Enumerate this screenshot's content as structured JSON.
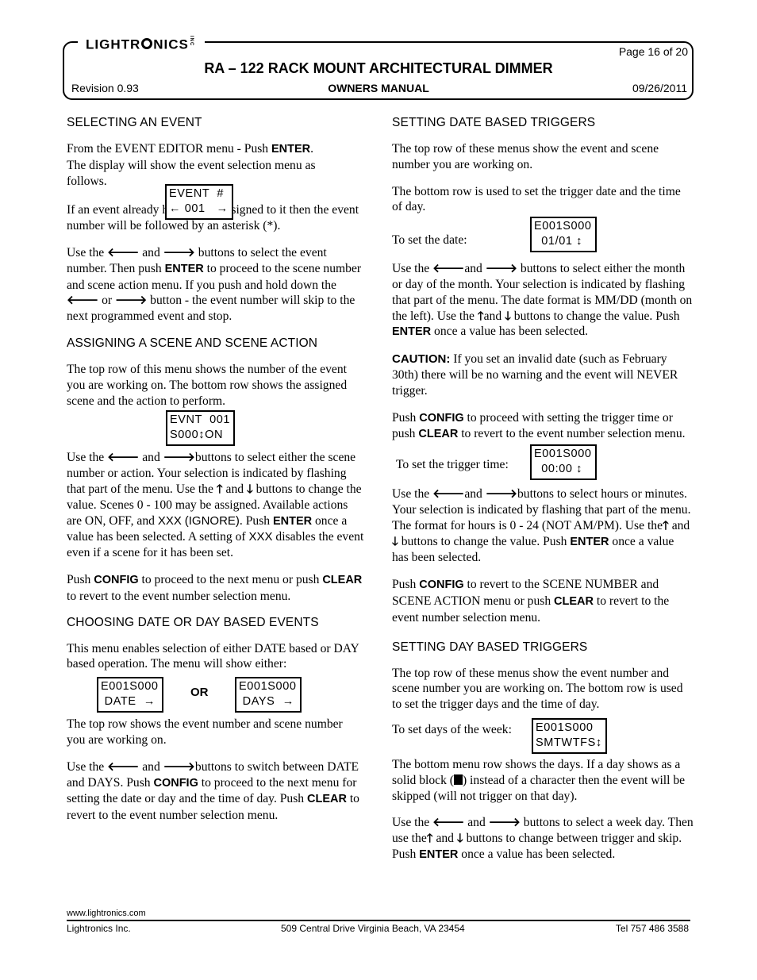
{
  "header": {
    "logo_text_a": "LIGHTR",
    "logo_text_b": "NICS",
    "logo_inc": "INC",
    "page_label": "Page 16 of 20",
    "title": "RA – 122 RACK MOUNT ARCHITECTURAL DIMMER",
    "revision": "Revision 0.93",
    "subtitle": "OWNERS MANUAL",
    "date": "09/26/2011"
  },
  "glyphs": {
    "left": "🡐",
    "right": "🡒",
    "up": "🡑",
    "down": "🡓"
  },
  "left": {
    "s1": {
      "heading": "SELECTING AN EVENT",
      "p1a": "From the EVENT EDITOR menu - Push ",
      "p1k": "ENTER",
      "p1b": ".",
      "p1c": "The display will show the event selection menu as",
      "p1d": "follows.",
      "lcd1": "EVENT  #",
      "lcd2": "← 001   →",
      "p2": "If an event already has a scene assigned to it then the event number will be followed by an asterisk (*).",
      "p3a": "Use the ",
      "p3b": "  and ",
      "p3c": " buttons to select the event number. Then push ",
      "p3k": "ENTER",
      "p3d": " to proceed to the scene number and scene action menu.  If you push and hold down the ",
      "p3e": " or ",
      "p3f": " button - the event number will skip to the next programmed event and stop."
    },
    "s2": {
      "heading": "ASSIGNING A SCENE AND SCENE ACTION",
      "p1": "The top row of this menu shows the number of the event you are working on.  The bottom row shows the assigned scene and the action to perform.",
      "lcd1": "EVNT  001",
      "lcd2": "S000↕ON",
      "p2a": "Use the ",
      "p2b": " and ",
      "p2c": "buttons to select either the scene number or action. Your selection is indicated by flashing that part of the menu.  Use the ",
      "p2d": " and ",
      "p2e": " buttons to change the value.  Scenes 0 - 100 may be assigned.  Available actions are ON, OFF, and ",
      "p2x": "XXX",
      "p2ig": "(IGNORE)",
      "p2f": ".  Push ",
      "p2k": "ENTER",
      "p2g": " once a value has been selected.  A setting of ",
      "p2x2": "XXX",
      "p2h": " disables the event even if a scene for it has been set.",
      "p3a": "Push ",
      "p3k1": "CONFIG",
      "p3b": " to proceed to the next menu or push ",
      "p3k2": "CLEAR",
      "p3c": " to revert to the event number selection menu."
    },
    "s3": {
      "heading": "CHOOSING DATE  OR DAY BASED EVENTS",
      "p1": "This menu enables selection of either DATE based or DAY based operation.  The menu will show either:",
      "lcdA1": "E001S000",
      "lcdA2": " DATE  →",
      "or_label": "OR",
      "lcdB1": "E001S000",
      "lcdB2": " DAYS  →",
      "p2": "The top row shows the event number and scene number you are working on.",
      "p3a": "Use the ",
      "p3b": "  and  ",
      "p3c": "buttons to switch between DATE and DAYS.  Push ",
      "p3k1": "CONFIG",
      "p3d": " to proceed to the next menu for setting the date or day and the time of day.  Push ",
      "p3k2": "CLEAR",
      "p3e": " to revert to the event number selection menu."
    }
  },
  "right": {
    "s1": {
      "heading": "SETTING DATE BASED TRIGGERS",
      "p1": "The top row of these menus show the event and scene number you are working on.",
      "p2": "The bottom row is used to set the trigger date and the time of day.",
      "label_date": "To set the date:",
      "lcd1": "E001S000",
      "lcd2": "  01/01 ↕",
      "p3a": "Use the ",
      "p3b": "and  ",
      "p3c": " buttons to select either the month or day of the month.  Your selection is indicated by flashing that part of the menu. The date format is MM/DD (month on the left). Use the  ",
      "p3d": "and ",
      "p3e": " buttons to change the value.  Push ",
      "p3k": "ENTER",
      "p3f": " once a value has been selected.",
      "caution_label": "CAUTION:",
      "caution_text": "  If you set an invalid date (such as February 30th)  there will be no warning and the event will NEVER trigger.",
      "p4a": "Push ",
      "p4k1": "CONFIG",
      "p4b": " to proceed with setting the trigger time or push ",
      "p4k2": "CLEAR",
      "p4c": " to revert to the event number selection menu.",
      "label_time": "To set the trigger time:",
      "lcd3": "E001S000",
      "lcd4": "  00:00 ↕",
      "p5a": "Use the ",
      "p5b": "and  ",
      "p5c": "buttons to select hours or minutes. Your selection is indicated by flashing that part of the menu. The format for hours is 0 - 24 (NOT AM/PM). Use the",
      "p5d": " and ",
      "p5e": " buttons to change the value.  Push ",
      "p5k": "ENTER",
      "p5f": " once a value has been selected.",
      "p6a": "Push ",
      "p6k1": "CONFIG",
      "p6b": " to revert to the SCENE NUMBER and SCENE ACTION menu or push ",
      "p6k2": "CLEAR",
      "p6c": " to revert to the event number selection menu."
    },
    "s2": {
      "heading": "SETTING DAY BASED TRIGGERS",
      "p1": "The top row of these menus show the event number and scene number you are working on. The bottom row is used to set the trigger days and the time of day.",
      "label_days": "To set days of the week:",
      "lcd1": "E001S000",
      "lcd2": "SMTWTFS↕",
      "p2a": "The bottom menu row shows the days. If a day shows as a solid block (",
      "p2b": ") instead of a character then the event will be skipped  (will not trigger on that day).",
      "p3a": "Use the ",
      "p3b": " and ",
      "p3c": " buttons to select a week day.  Then use the",
      "p3d": " and ",
      "p3e": " buttons to change between trigger and skip.  Push ",
      "p3k": "ENTER",
      "p3f": " once a value has been selected."
    }
  },
  "footer": {
    "url": "www.lightronics.com",
    "company": "Lightronics Inc.",
    "address": "509 Central Drive  Virginia Beach,  VA  23454",
    "phone": "Tel  757 486 3588"
  }
}
